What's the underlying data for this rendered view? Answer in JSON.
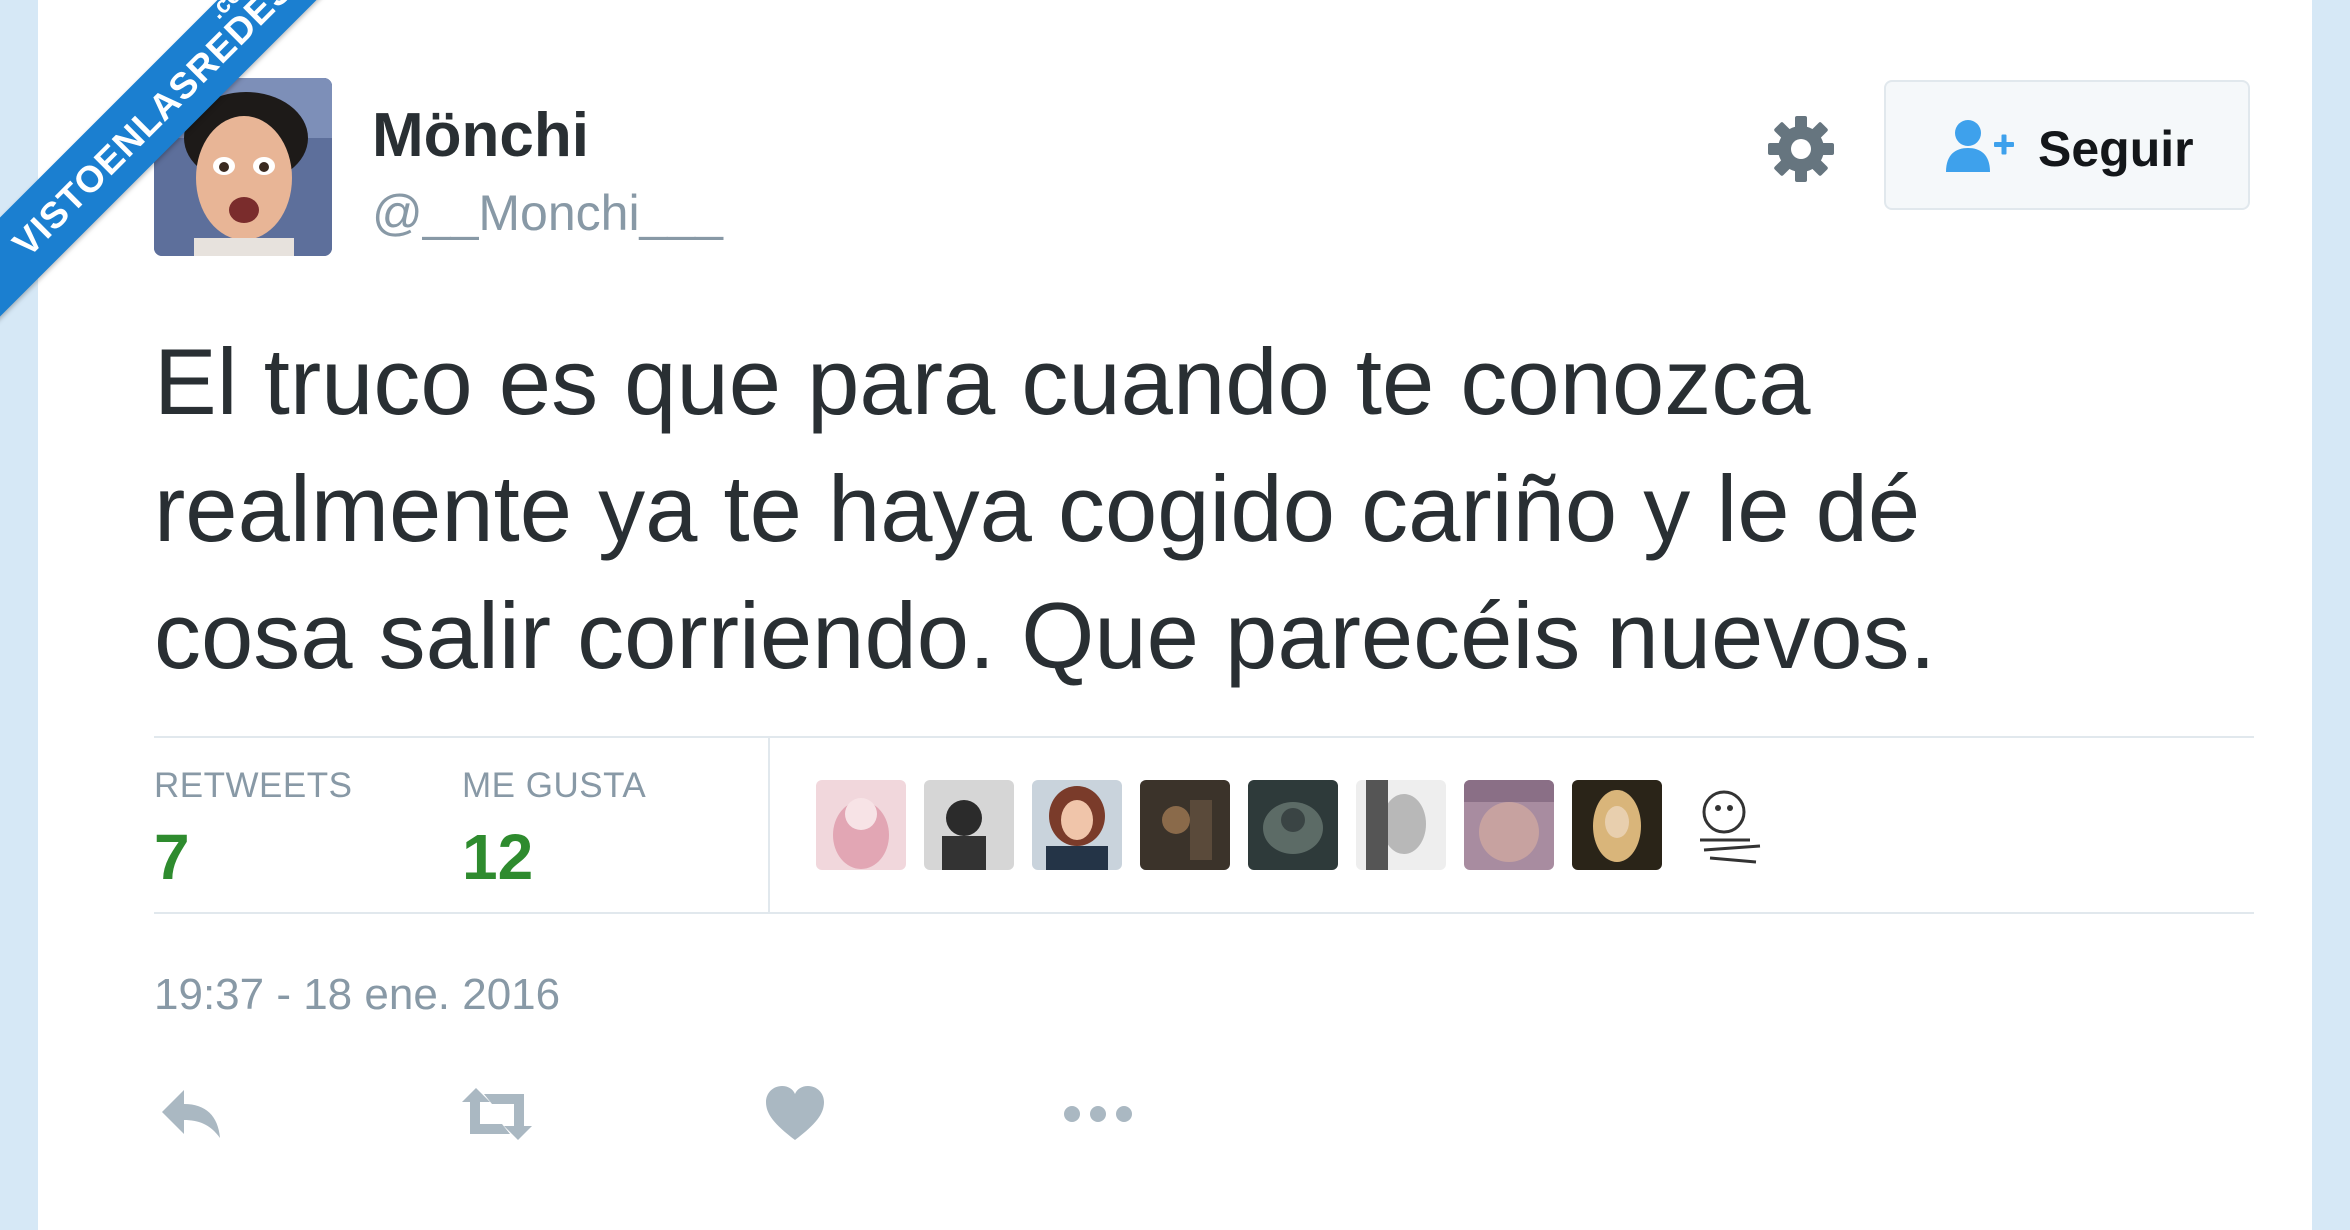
{
  "watermark": {
    "text": "VISTOENLASREDES",
    "suffix": ".com"
  },
  "user": {
    "name": "Mönchi",
    "handle": "@__Monchi___"
  },
  "follow_button": {
    "label": "Seguir"
  },
  "tweet": {
    "lines": [
      "El truco es que para cuando te conozca",
      "realmente ya te haya cogido cariño y le dé",
      "cosa salir corriendo. Que parecéis nuevos."
    ]
  },
  "stats": {
    "retweets_label": "RETWEETS",
    "retweets_value": "7",
    "likes_label": "ME GUSTA",
    "likes_value": "12"
  },
  "likers_count_shown": 9,
  "timestamp": "19:37 - 18 ene. 2016",
  "colors": {
    "background": "#d6e8f6",
    "watermark": "#1b7fd0",
    "stat_value": "#2e8b2e",
    "muted": "#8899a6",
    "follow_icon": "#3ea1ec"
  },
  "icons": {
    "settings": "gear-icon",
    "follow": "add-user-icon",
    "reply": "reply-icon",
    "retweet": "retweet-icon",
    "like": "heart-icon",
    "more": "more-icon"
  }
}
